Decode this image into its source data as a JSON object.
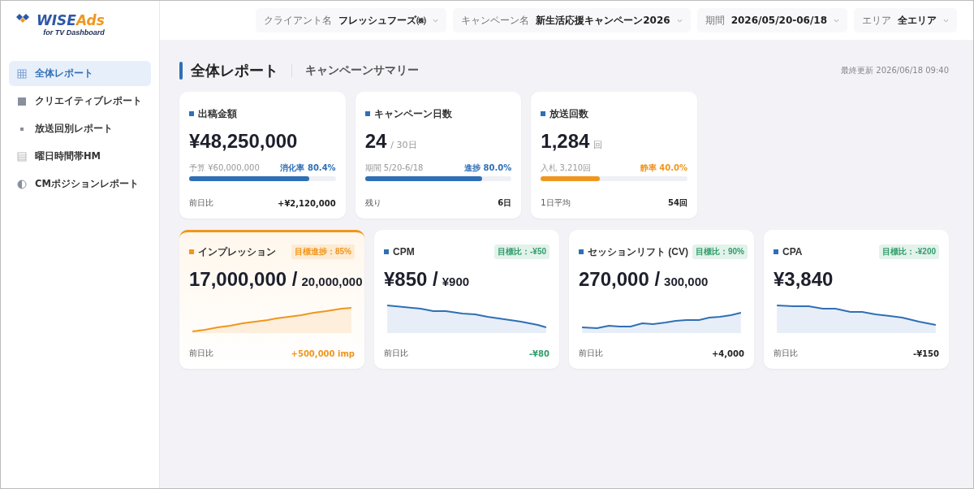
{
  "logo": {
    "main": "WISE",
    "accent": "Ads",
    "tagline": "for TV Dashboard"
  },
  "sidebar": {
    "items": [
      {
        "label": "全体レポート",
        "kind": "grid",
        "selected": true
      },
      {
        "label": "クリエイティブレポート",
        "kind": "square",
        "selected": false
      },
      {
        "label": "放送回別レポート",
        "kind": "dot",
        "selected": false
      },
      {
        "label": "曜日時間帯HM",
        "kind": "list",
        "selected": false
      },
      {
        "label": "CMポジションレポート",
        "kind": "half",
        "selected": false
      }
    ]
  },
  "filters": [
    {
      "label": "クライアント名",
      "value": "フレッシュフーズ㈱"
    },
    {
      "label": "キャンペーン名",
      "value": "新生活応援キャンペーン2026"
    },
    {
      "label": "期間",
      "value": "2026/05/20-06/18"
    },
    {
      "label": "エリア",
      "value": "全エリア"
    }
  ],
  "page": {
    "title": "全体レポート",
    "subtitle": "キャンペーンサマリー",
    "updated": "最終更新 2026/06/18 09:40"
  },
  "summary_cards": [
    {
      "title": "出稿金額",
      "value": "¥48,250,000",
      "left_note": "予算 ¥60,000,000",
      "right_note": "消化率 80.4%",
      "level": 0.82,
      "color": "#2f6fb6",
      "footer": {
        "label": "前日比",
        "value": "+¥2,120,000"
      }
    },
    {
      "title": "キャンペーン日数",
      "value": "24",
      "unit": "/ 30日",
      "left_note": "期間 5/20-6/18",
      "right_note": "進捗 80.0%",
      "level": 0.8,
      "color": "#2f6fb6",
      "footer": {
        "label": "残り",
        "value": "6日"
      }
    },
    {
      "title": "放送回数",
      "value": "1,284",
      "unit": "回",
      "left_note": "入札 3,210回",
      "right_note": "静率 40.0%",
      "level": 0.4,
      "color": "#f0961e",
      "footer": {
        "label": "1日平均",
        "value": "54回"
      }
    }
  ],
  "kpi_cards": [
    {
      "title": "インプレッション",
      "badge": "目標進捗：85%",
      "color": "#f0961e",
      "selected": true,
      "value": "17,000,000 /",
      "target": "20,000,000",
      "footer": {
        "label": "前日比",
        "value": "+500,000 imp",
        "color": "#f0961e"
      }
    },
    {
      "title": "CPM",
      "badge": "目標比：-¥50",
      "color": "#2f9e6a",
      "selected": false,
      "value": "¥850 /",
      "target": "¥900",
      "footer": {
        "label": "前日比",
        "value": "-¥80",
        "color": "#2f9e6a"
      }
    },
    {
      "title": "セッションリフト (CV)",
      "badge": "目標比：90%",
      "color": "#2f9e6a",
      "selected": false,
      "value": "270,000 /",
      "target": "300,000",
      "footer": {
        "label": "前日比",
        "value": "+4,000",
        "color": "#222222"
      }
    },
    {
      "title": "CPA",
      "badge": "目標比：-¥200",
      "color": "#2f9e6a",
      "selected": false,
      "value": "¥3,840",
      "footer": {
        "label": "前日比",
        "value": "-¥150",
        "color": "#222222"
      }
    }
  ]
}
